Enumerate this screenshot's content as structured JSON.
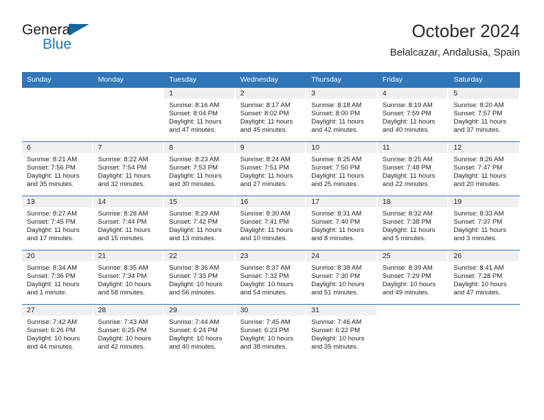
{
  "brand": {
    "name_part1": "General",
    "name_part2": "Blue",
    "accent_color": "#1a7bc4",
    "triangle_color": "#14669e"
  },
  "header": {
    "title": "October 2024",
    "subtitle": "Belalcazar, Andalusia, Spain"
  },
  "theme": {
    "header_blue": "#3176b8",
    "day_band_gray": "#f0f0f0",
    "text": "#222222"
  },
  "calendar": {
    "weekday_headers": [
      "Sunday",
      "Monday",
      "Tuesday",
      "Wednesday",
      "Thursday",
      "Friday",
      "Saturday"
    ],
    "weeks": [
      [
        {
          "day": "",
          "blank": true
        },
        {
          "day": "",
          "blank": true
        },
        {
          "day": "1",
          "sunrise": "Sunrise: 8:16 AM",
          "sunset": "Sunset: 8:04 PM",
          "daylight1": "Daylight: 11 hours",
          "daylight2": "and 47 minutes."
        },
        {
          "day": "2",
          "sunrise": "Sunrise: 8:17 AM",
          "sunset": "Sunset: 8:02 PM",
          "daylight1": "Daylight: 11 hours",
          "daylight2": "and 45 minutes."
        },
        {
          "day": "3",
          "sunrise": "Sunrise: 8:18 AM",
          "sunset": "Sunset: 8:00 PM",
          "daylight1": "Daylight: 11 hours",
          "daylight2": "and 42 minutes."
        },
        {
          "day": "4",
          "sunrise": "Sunrise: 8:19 AM",
          "sunset": "Sunset: 7:59 PM",
          "daylight1": "Daylight: 11 hours",
          "daylight2": "and 40 minutes."
        },
        {
          "day": "5",
          "sunrise": "Sunrise: 8:20 AM",
          "sunset": "Sunset: 7:57 PM",
          "daylight1": "Daylight: 11 hours",
          "daylight2": "and 37 minutes."
        }
      ],
      [
        {
          "day": "6",
          "sunrise": "Sunrise: 8:21 AM",
          "sunset": "Sunset: 7:56 PM",
          "daylight1": "Daylight: 11 hours",
          "daylight2": "and 35 minutes."
        },
        {
          "day": "7",
          "sunrise": "Sunrise: 8:22 AM",
          "sunset": "Sunset: 7:54 PM",
          "daylight1": "Daylight: 11 hours",
          "daylight2": "and 32 minutes."
        },
        {
          "day": "8",
          "sunrise": "Sunrise: 8:23 AM",
          "sunset": "Sunset: 7:53 PM",
          "daylight1": "Daylight: 11 hours",
          "daylight2": "and 30 minutes."
        },
        {
          "day": "9",
          "sunrise": "Sunrise: 8:24 AM",
          "sunset": "Sunset: 7:51 PM",
          "daylight1": "Daylight: 11 hours",
          "daylight2": "and 27 minutes."
        },
        {
          "day": "10",
          "sunrise": "Sunrise: 8:25 AM",
          "sunset": "Sunset: 7:50 PM",
          "daylight1": "Daylight: 11 hours",
          "daylight2": "and 25 minutes."
        },
        {
          "day": "11",
          "sunrise": "Sunrise: 8:25 AM",
          "sunset": "Sunset: 7:48 PM",
          "daylight1": "Daylight: 11 hours",
          "daylight2": "and 22 minutes."
        },
        {
          "day": "12",
          "sunrise": "Sunrise: 8:26 AM",
          "sunset": "Sunset: 7:47 PM",
          "daylight1": "Daylight: 11 hours",
          "daylight2": "and 20 minutes."
        }
      ],
      [
        {
          "day": "13",
          "sunrise": "Sunrise: 8:27 AM",
          "sunset": "Sunset: 7:45 PM",
          "daylight1": "Daylight: 11 hours",
          "daylight2": "and 17 minutes."
        },
        {
          "day": "14",
          "sunrise": "Sunrise: 8:28 AM",
          "sunset": "Sunset: 7:44 PM",
          "daylight1": "Daylight: 11 hours",
          "daylight2": "and 15 minutes."
        },
        {
          "day": "15",
          "sunrise": "Sunrise: 8:29 AM",
          "sunset": "Sunset: 7:42 PM",
          "daylight1": "Daylight: 11 hours",
          "daylight2": "and 13 minutes."
        },
        {
          "day": "16",
          "sunrise": "Sunrise: 8:30 AM",
          "sunset": "Sunset: 7:41 PM",
          "daylight1": "Daylight: 11 hours",
          "daylight2": "and 10 minutes."
        },
        {
          "day": "17",
          "sunrise": "Sunrise: 8:31 AM",
          "sunset": "Sunset: 7:40 PM",
          "daylight1": "Daylight: 11 hours",
          "daylight2": "and 8 minutes."
        },
        {
          "day": "18",
          "sunrise": "Sunrise: 8:32 AM",
          "sunset": "Sunset: 7:38 PM",
          "daylight1": "Daylight: 11 hours",
          "daylight2": "and 5 minutes."
        },
        {
          "day": "19",
          "sunrise": "Sunrise: 8:33 AM",
          "sunset": "Sunset: 7:37 PM",
          "daylight1": "Daylight: 11 hours",
          "daylight2": "and 3 minutes."
        }
      ],
      [
        {
          "day": "20",
          "sunrise": "Sunrise: 8:34 AM",
          "sunset": "Sunset: 7:36 PM",
          "daylight1": "Daylight: 11 hours",
          "daylight2": "and 1 minute."
        },
        {
          "day": "21",
          "sunrise": "Sunrise: 8:35 AM",
          "sunset": "Sunset: 7:34 PM",
          "daylight1": "Daylight: 10 hours",
          "daylight2": "and 58 minutes."
        },
        {
          "day": "22",
          "sunrise": "Sunrise: 8:36 AM",
          "sunset": "Sunset: 7:33 PM",
          "daylight1": "Daylight: 10 hours",
          "daylight2": "and 56 minutes."
        },
        {
          "day": "23",
          "sunrise": "Sunrise: 8:37 AM",
          "sunset": "Sunset: 7:32 PM",
          "daylight1": "Daylight: 10 hours",
          "daylight2": "and 54 minutes."
        },
        {
          "day": "24",
          "sunrise": "Sunrise: 8:38 AM",
          "sunset": "Sunset: 7:30 PM",
          "daylight1": "Daylight: 10 hours",
          "daylight2": "and 51 minutes."
        },
        {
          "day": "25",
          "sunrise": "Sunrise: 8:39 AM",
          "sunset": "Sunset: 7:29 PM",
          "daylight1": "Daylight: 10 hours",
          "daylight2": "and 49 minutes."
        },
        {
          "day": "26",
          "sunrise": "Sunrise: 8:41 AM",
          "sunset": "Sunset: 7:28 PM",
          "daylight1": "Daylight: 10 hours",
          "daylight2": "and 47 minutes."
        }
      ],
      [
        {
          "day": "27",
          "sunrise": "Sunrise: 7:42 AM",
          "sunset": "Sunset: 6:26 PM",
          "daylight1": "Daylight: 10 hours",
          "daylight2": "and 44 minutes."
        },
        {
          "day": "28",
          "sunrise": "Sunrise: 7:43 AM",
          "sunset": "Sunset: 6:25 PM",
          "daylight1": "Daylight: 10 hours",
          "daylight2": "and 42 minutes."
        },
        {
          "day": "29",
          "sunrise": "Sunrise: 7:44 AM",
          "sunset": "Sunset: 6:24 PM",
          "daylight1": "Daylight: 10 hours",
          "daylight2": "and 40 minutes."
        },
        {
          "day": "30",
          "sunrise": "Sunrise: 7:45 AM",
          "sunset": "Sunset: 6:23 PM",
          "daylight1": "Daylight: 10 hours",
          "daylight2": "and 38 minutes."
        },
        {
          "day": "31",
          "sunrise": "Sunrise: 7:46 AM",
          "sunset": "Sunset: 6:22 PM",
          "daylight1": "Daylight: 10 hours",
          "daylight2": "and 35 minutes."
        },
        {
          "day": "",
          "blank": true
        },
        {
          "day": "",
          "blank": true
        }
      ]
    ]
  }
}
